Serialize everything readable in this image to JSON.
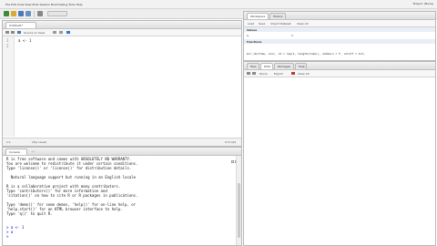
{
  "menubar": {
    "menu_label": "File  Edit  Code  View  Plots  Session  Build  Debug  Tools  Help",
    "project_label": "Project: (None)"
  },
  "source": {
    "tab_label": "Untitled1*",
    "toolbar": {
      "source_on_save": "Source on Save"
    },
    "lines": [
      "a <- 1",
      ""
    ],
    "line_numbers": [
      "1",
      "2"
    ],
    "status": {
      "position": "1:1",
      "scope": "(Top Level)",
      "filetype": "R Script"
    }
  },
  "console": {
    "tab_label": "Console",
    "path": "~/",
    "lines": [
      "R is free software and comes with ABSOLUTELY NO WARRANTY.",
      "You are welcome to redistribute it under certain conditions.",
      "Type 'license()' or 'licence()' for distribution details.",
      "",
      "  Natural language support but running in an English locale",
      "",
      "R is a collaborative project with many contributors.",
      "Type 'contributors()' for more information and",
      "'citation()' on how to cite R or R packages in publications.",
      "",
      "Type 'demo()' for some demos, 'help()' for on-line help, or",
      "'help.start()' for an HTML browser interface to help.",
      "Type 'q()' to quit R.",
      "",
      "> a <- 1",
      "> a",
      "> "
    ]
  },
  "workspace": {
    "tabs": [
      "Workspace",
      "History"
    ],
    "toolbar": [
      "Load",
      "Save",
      "Import Dataset",
      "Clear All"
    ],
    "values_header": "Values",
    "values": [
      {
        "name": "a",
        "value": "1"
      }
    ],
    "functions_header": "Functions",
    "functions": [
      "mvr_lm(time, conc, id = rep(1, length(time)), addzero = F, cutoff = Inf,",
      "    infinity = F)"
    ]
  },
  "files": {
    "tabs": [
      "Files",
      "Plots",
      "Packages",
      "Help"
    ],
    "toolbar": [
      "Zoom",
      "Export",
      "Clear All"
    ]
  }
}
